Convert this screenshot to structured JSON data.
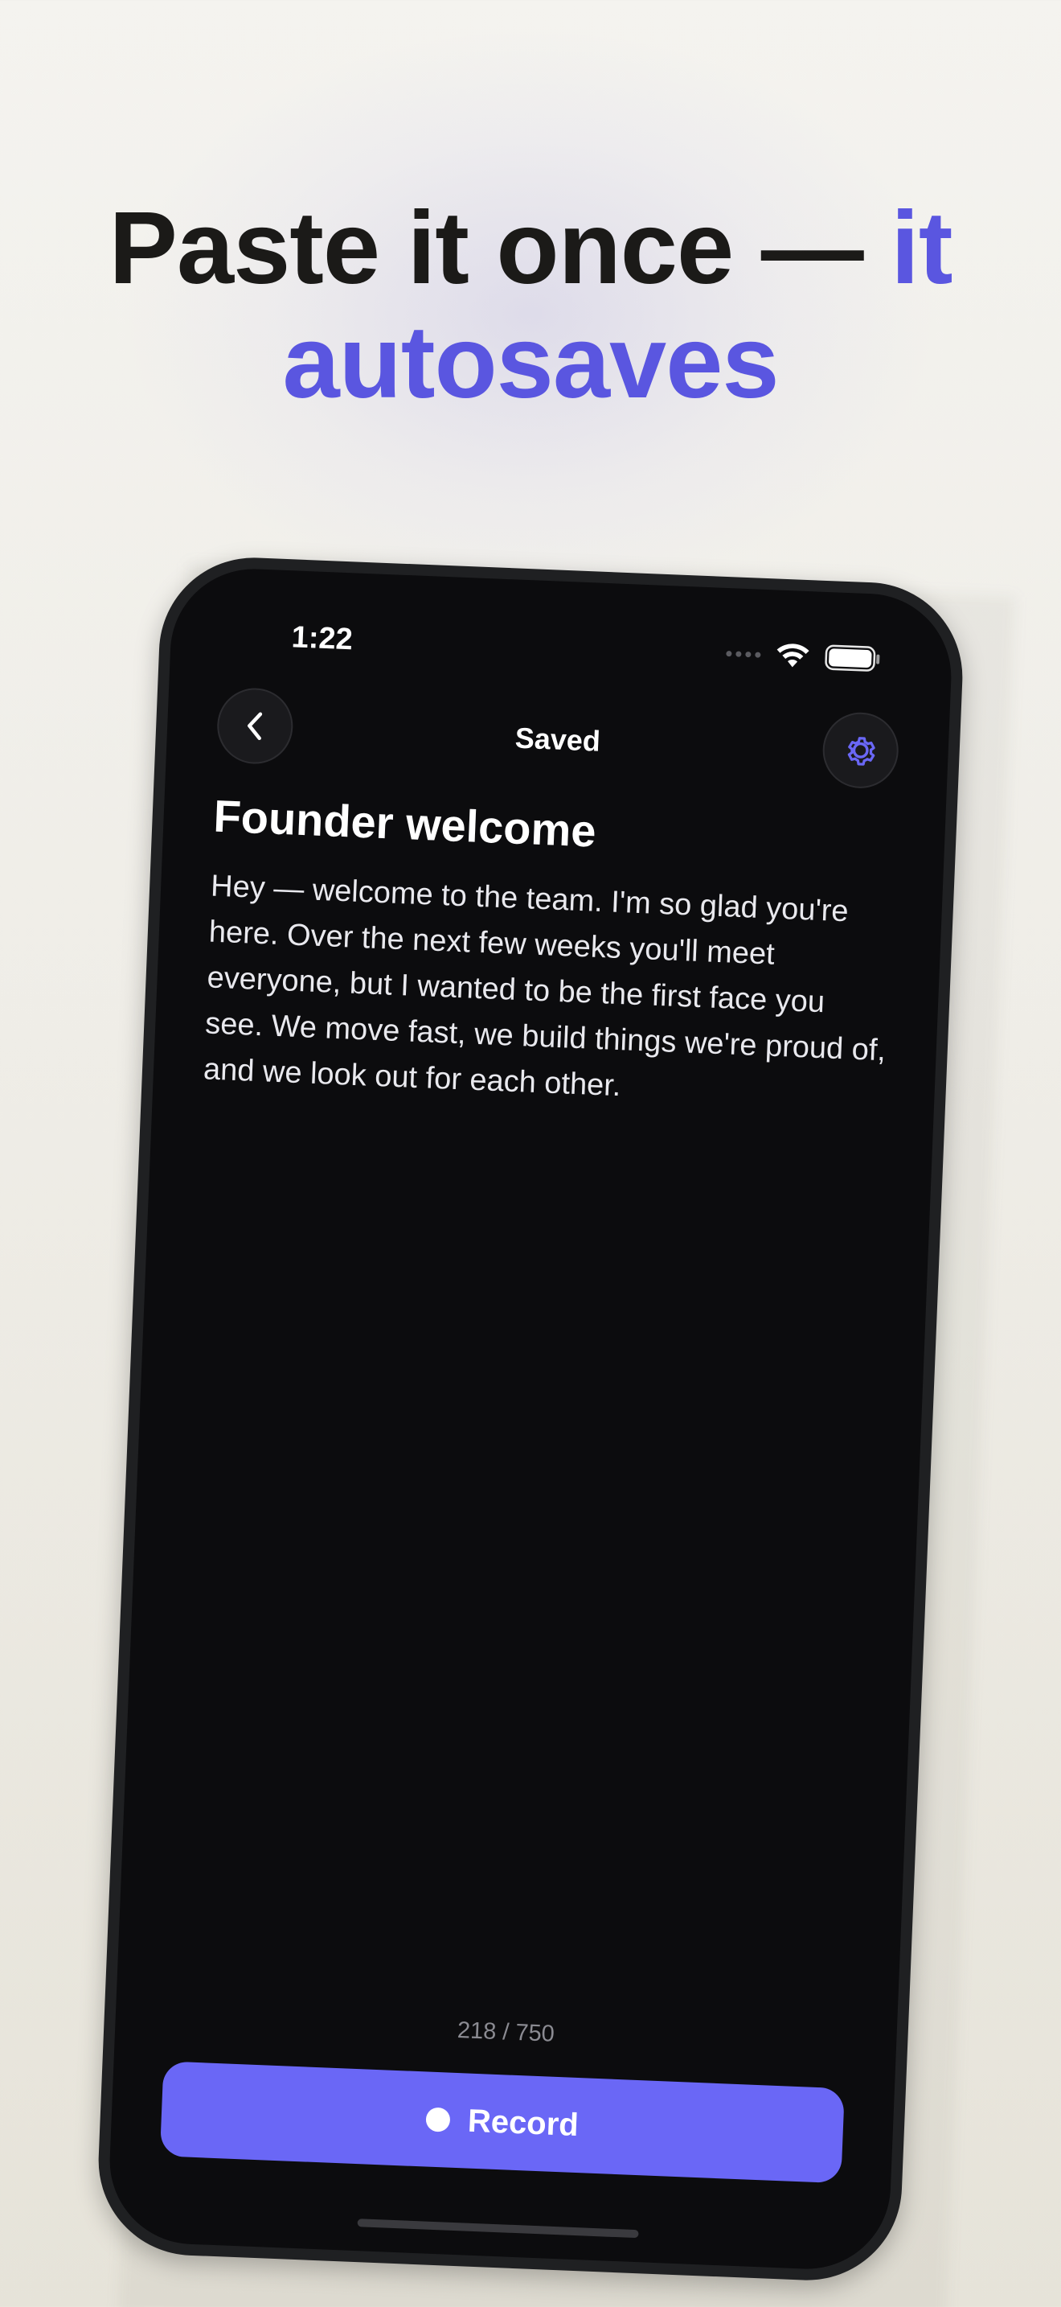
{
  "headline": {
    "line1": "Paste it once — ",
    "accent1": "it",
    "accent2": "autosaves"
  },
  "status_bar": {
    "time": "1:22",
    "icons": [
      "cellular-icon",
      "wifi-icon",
      "battery-icon"
    ]
  },
  "nav": {
    "back_icon": "chevron-left-icon",
    "title": "Saved",
    "settings_icon": "gear-icon"
  },
  "document": {
    "title": "Founder welcome",
    "body": "Hey — welcome to the team. I'm so glad you're here. Over the next few weeks you'll meet everyone, but I wanted to be the first face you see. We move fast, we build things we're proud of, and we look out for each other."
  },
  "footer": {
    "char_count": "218 / 750",
    "record_label": "Record"
  },
  "colors": {
    "accent": "#5a56e0",
    "button": "#6a67f6",
    "screen_bg": "#0c0c0e"
  }
}
